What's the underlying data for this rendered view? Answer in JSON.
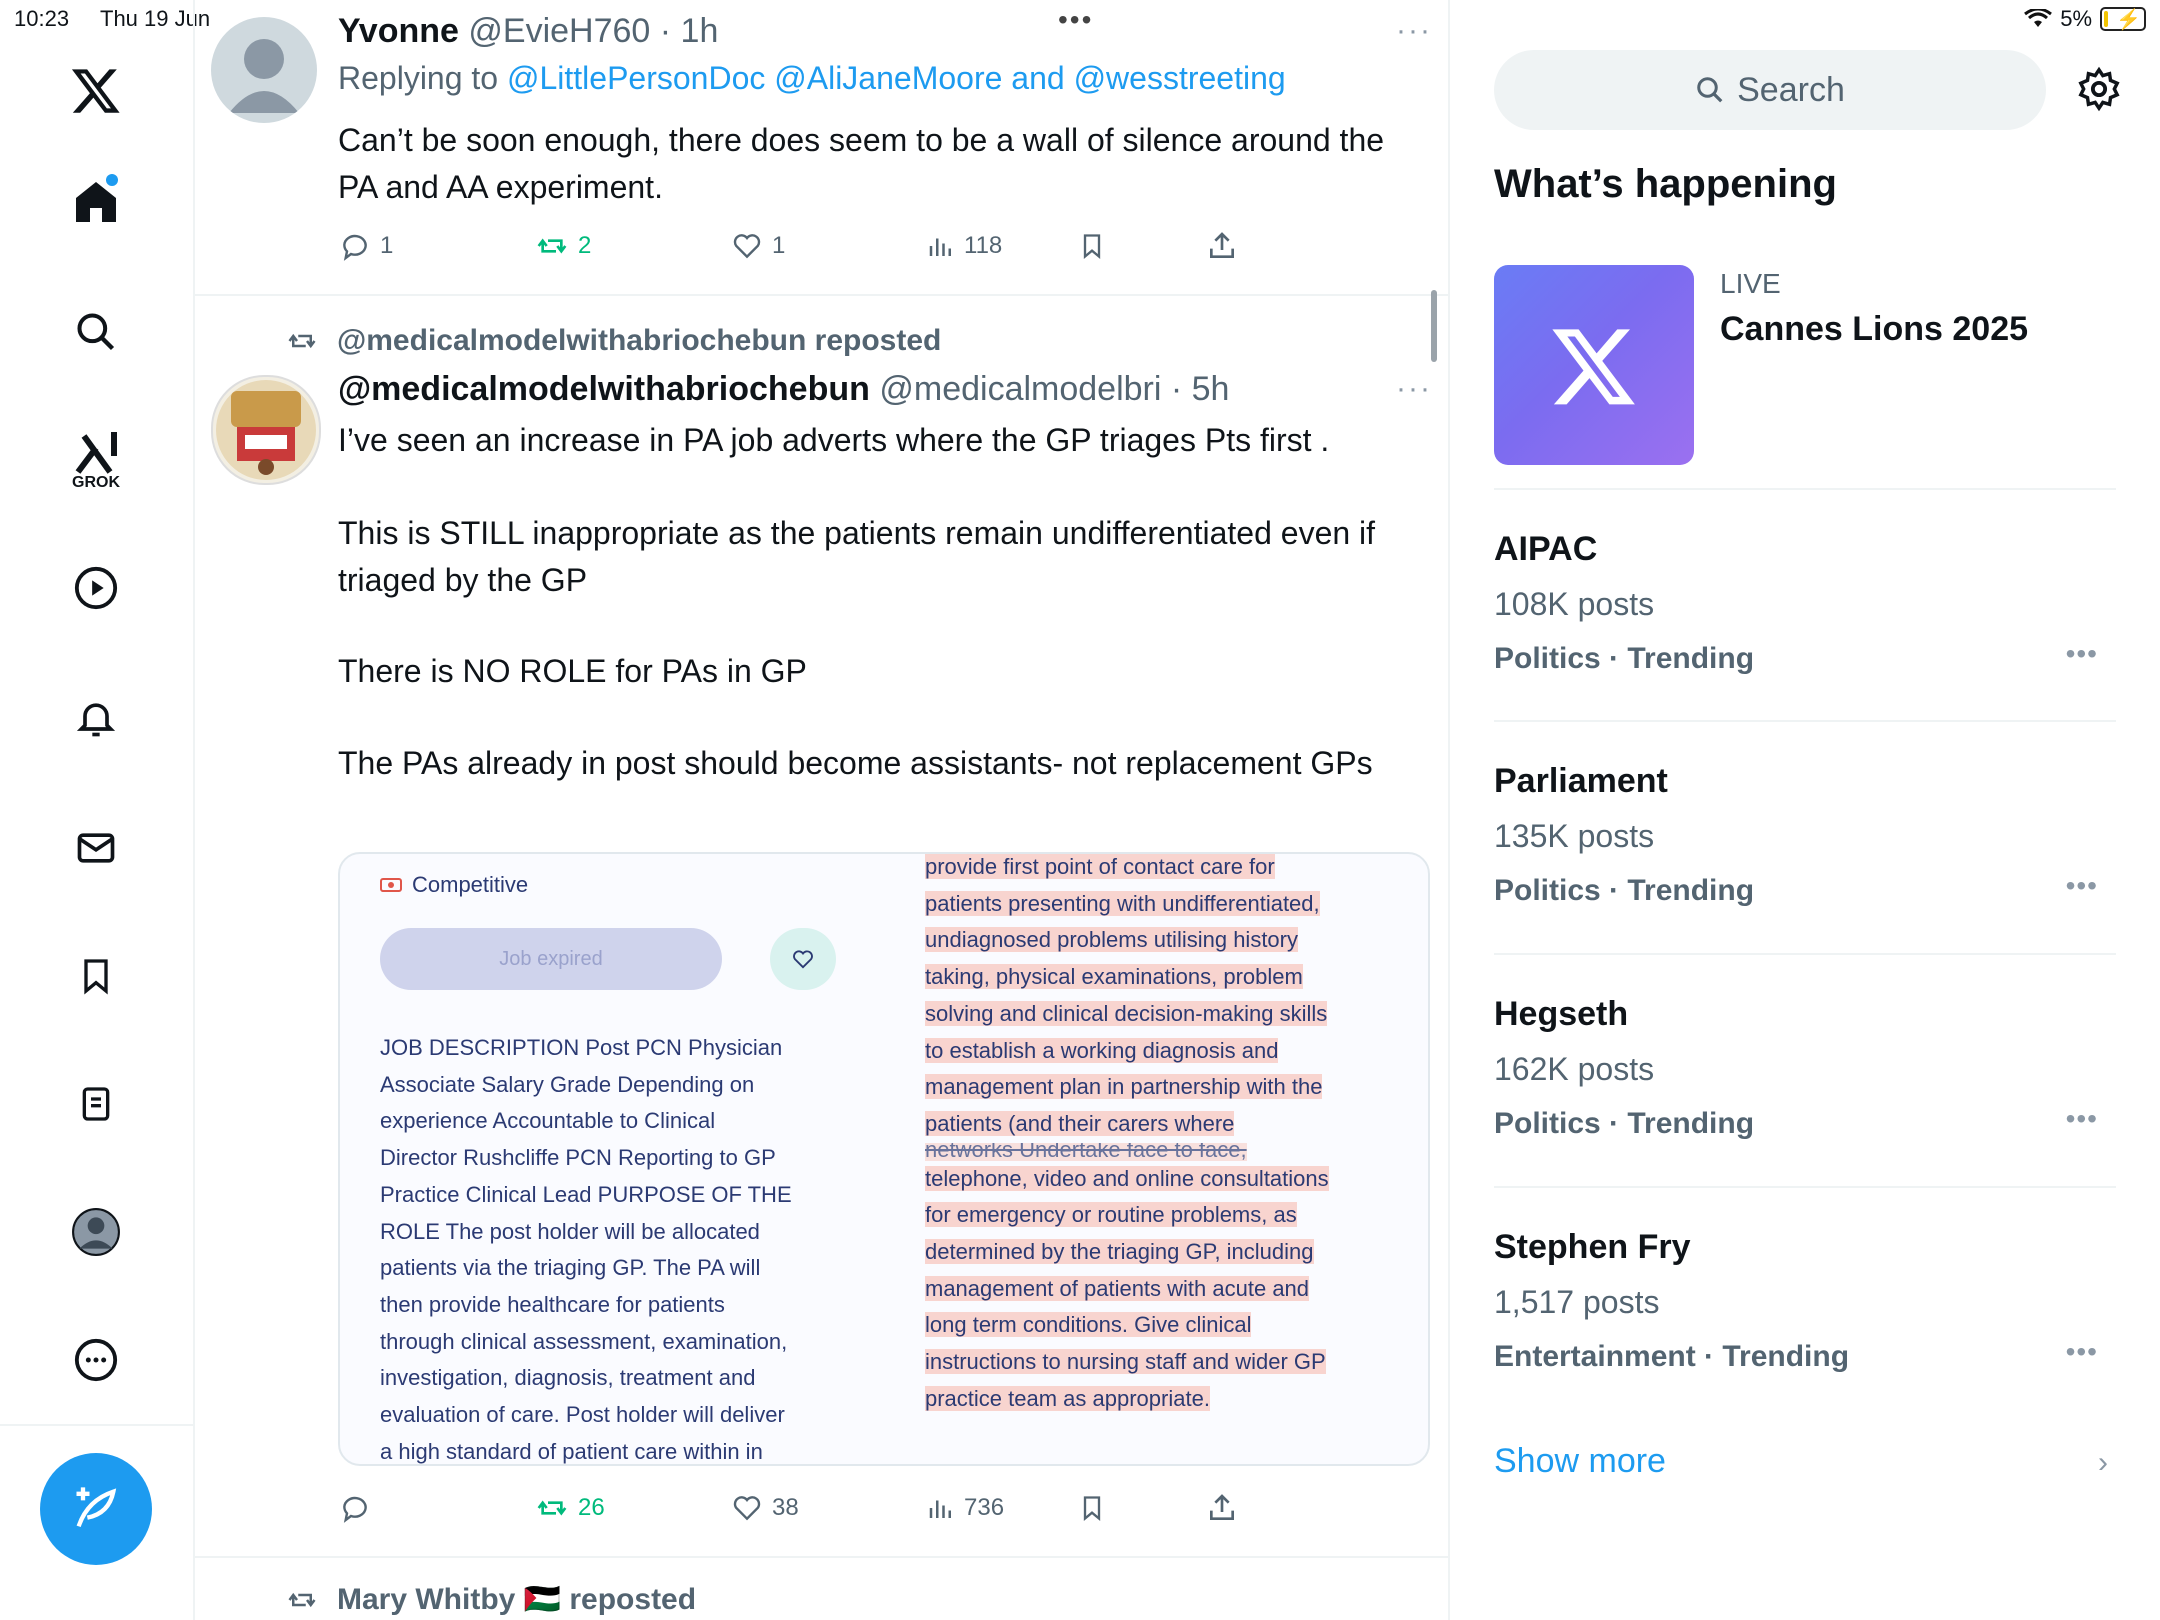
{
  "status": {
    "time": "10:23",
    "date": "Thu 19 Jun",
    "battery": "5%"
  },
  "nav": {
    "grok_label": "GROK"
  },
  "tweets": [
    {
      "name": "Yvonne",
      "handle": "@EvieH760",
      "time": "· 1h",
      "reply_prefix": "Replying to",
      "reply_to": "@LittlePersonDoc @AliJaneMoore and @wesstreeting",
      "text": "Can’t be soon enough, there does seem to be a wall of silence around the PA and AA experiment.",
      "replies": "1",
      "reposts": "2",
      "likes": "1",
      "views": "118"
    },
    {
      "reposted_by": "@medicalmodelwithabriochebun reposted",
      "name": "@medicalmodelwithabriochebun",
      "handle": "@medicalmodelbri",
      "time": "· 5h",
      "p1": "I’ve seen an increase in PA job adverts where the GP triages Pts first .",
      "p2": "This is STILL inappropriate as the patients remain undifferentiated even if triaged by the GP",
      "p3": "There is NO ROLE for PAs in GP",
      "p4": "The PAs already in post should become assistants- not replacement GPs",
      "replies": "",
      "reposts": "26",
      "likes": "38",
      "views": "736"
    },
    {
      "reposted_by": "Mary Whitby 🇵🇸 reposted"
    }
  ],
  "embed": {
    "salary": "Competitive",
    "button": "Job expired",
    "left_lines": [
      "JOB DESCRIPTION Post PCN Physician",
      "Associate Salary Grade Depending on",
      "experience Accountable to Clinical",
      "Director Rushcliffe PCN Reporting to GP",
      "Practice Clinical Lead PURPOSE OF THE",
      "ROLE The post holder will be allocated",
      "patients via the triaging GP. The PA will",
      "then provide healthcare for patients",
      "through clinical assessment, examination,",
      "investigation, diagnosis, treatment and",
      "evaluation of care. Post holder will deliver",
      "a high standard of patient care within in"
    ],
    "right_lines": [
      "provide first point of contact care for",
      "patients presenting with undifferentiated,",
      "undiagnosed problems utilising history",
      "taking, physical examinations, problem",
      "solving and clinical decision-making skills",
      "to establish a working diagnosis and",
      "management plan in partnership with the",
      "patients (and their carers where",
      "networks Undertake face to face,",
      "telephone, video and online consultations",
      "for emergency or routine problems, as",
      "determined by the triaging GP, including",
      "management of patients with acute and",
      "long term conditions. Give clinical",
      "instructions to nursing staff and wider GP",
      "practice team as appropriate."
    ]
  },
  "sidebar": {
    "search_placeholder": "Search",
    "heading": "What’s happening",
    "live_label": "LIVE",
    "live_title": "Cannes Lions 2025",
    "trends": [
      {
        "title": "AIPAC",
        "count": "108K posts",
        "category": "Politics · Trending"
      },
      {
        "title": "Parliament",
        "count": "135K posts",
        "category": "Politics · Trending"
      },
      {
        "title": "Hegseth",
        "count": "162K posts",
        "category": "Politics · Trending"
      },
      {
        "title": "Stephen Fry",
        "count": "1,517 posts",
        "category": "Entertainment · Trending"
      }
    ],
    "show_more": "Show more"
  },
  "colors": {
    "accent": "#1d9bf0",
    "repost_green": "#00ba7c",
    "muted": "#536471"
  }
}
